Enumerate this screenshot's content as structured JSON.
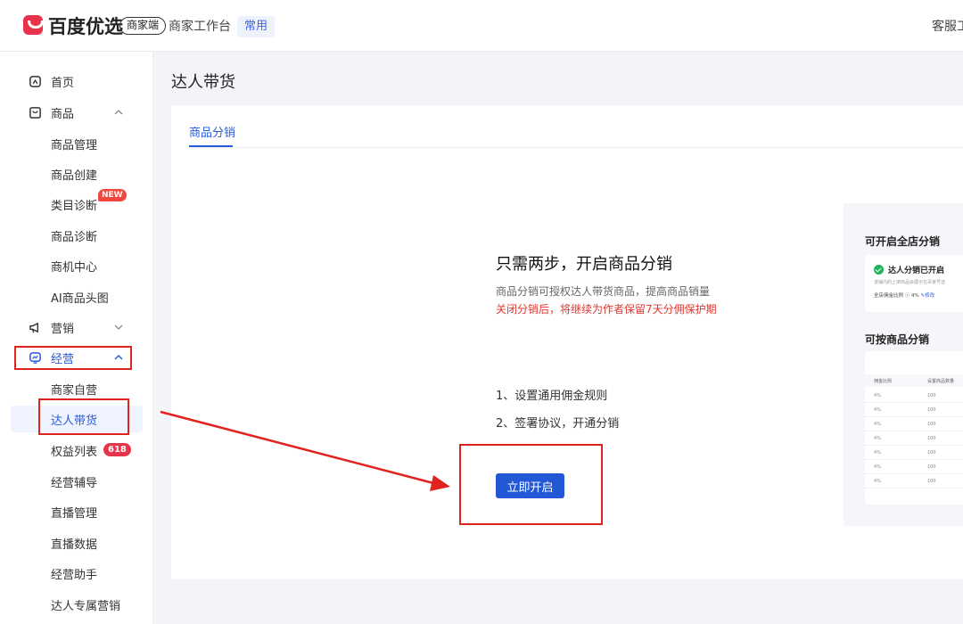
{
  "header": {
    "logo_text": "百度优选",
    "merchant_badge": "商家端",
    "workbench": "商家工作台",
    "common_tag": "常用",
    "customer_service": "客服工"
  },
  "sidebar": {
    "items": [
      {
        "label": "首页",
        "icon": "home-icon"
      },
      {
        "label": "商品",
        "icon": "goods-icon"
      },
      {
        "label": "商品管理"
      },
      {
        "label": "商品创建"
      },
      {
        "label": "类目诊断",
        "badge": "NEW"
      },
      {
        "label": "商品诊断"
      },
      {
        "label": "商机中心"
      },
      {
        "label": "AI商品头图"
      },
      {
        "label": "营销",
        "icon": "megaphone-icon"
      },
      {
        "label": "经营",
        "icon": "operation-icon"
      },
      {
        "label": "商家自营"
      },
      {
        "label": "达人带货"
      },
      {
        "label": "权益列表",
        "badge": "618"
      },
      {
        "label": "经营辅导"
      },
      {
        "label": "直播管理"
      },
      {
        "label": "直播数据"
      },
      {
        "label": "经营助手"
      },
      {
        "label": "达人专属营销"
      }
    ]
  },
  "main": {
    "page_title": "达人带货",
    "tab": "商品分销",
    "hero_title": "只需两步，开启商品分销",
    "hero_desc": "商品分销可授权达人带货商品，提高商品销量",
    "hero_warning": "关闭分销后，将继续为作者保留7天分佣保护期",
    "steps": [
      "1、设置通用佣金规则",
      "2、签署协议，开通分销"
    ],
    "cta_button": "立即开启"
  },
  "preview": {
    "title_store": "可开启全店分销",
    "enabled_label": "达人分销已开启",
    "enabled_desc": "该铺内的上架商品会展示在百家号选",
    "rate_label": "全店佣金比例",
    "rate_value": "4%",
    "rate_edit": "修改",
    "title_goods": "可按商品分销",
    "table_headers": [
      "佣金比例",
      "设置商品数量"
    ],
    "table_rows": [
      [
        "4%",
        "100"
      ],
      [
        "4%",
        "100"
      ],
      [
        "4%",
        "100"
      ],
      [
        "4%",
        "100"
      ],
      [
        "4%",
        "100"
      ],
      [
        "4%",
        "100"
      ],
      [
        "4%",
        "100"
      ]
    ]
  },
  "colors": {
    "accent": "#2a5bd7",
    "button": "#2258d5",
    "warning": "#e0372f",
    "annotation": "#e0231f",
    "brand": "#e8344a"
  }
}
